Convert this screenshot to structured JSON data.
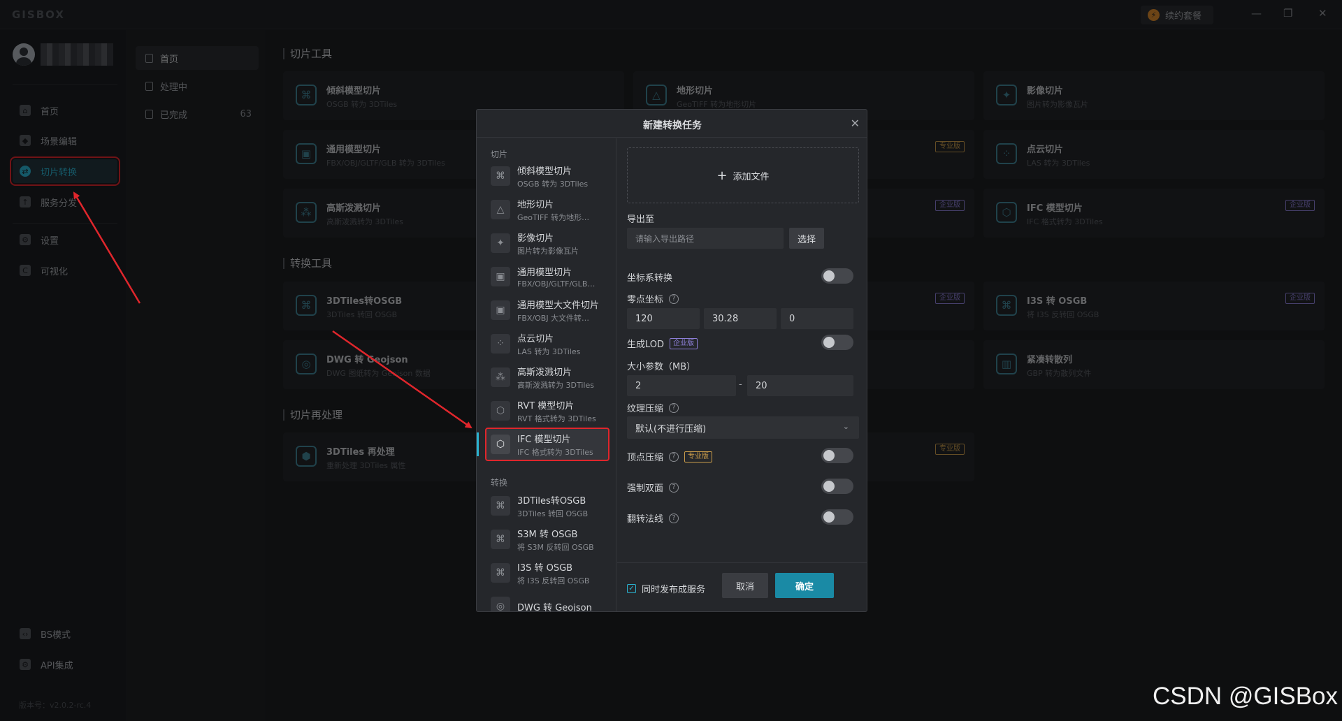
{
  "app": {
    "logo": "GISBOX",
    "renew_label": "续约套餐",
    "window_controls": [
      "—",
      "❐",
      "✕"
    ],
    "version": "版本号：v2.0.2-rc.4"
  },
  "leftnav": {
    "items": [
      {
        "label": "首页",
        "icon": "home-icon"
      },
      {
        "label": "场景编辑",
        "icon": "cube-icon"
      },
      {
        "label": "切片转换",
        "icon": "convert-icon"
      },
      {
        "label": "服务分发",
        "icon": "upload-icon"
      },
      {
        "label": "设置",
        "icon": "gear-icon"
      },
      {
        "label": "可视化",
        "icon": "chart-icon"
      }
    ],
    "bottom": [
      {
        "label": "BS模式",
        "icon": "code-icon"
      },
      {
        "label": "API集成",
        "icon": "api-icon"
      }
    ]
  },
  "subnav": {
    "items": [
      {
        "label": "首页",
        "count": ""
      },
      {
        "label": "处理中",
        "count": ""
      },
      {
        "label": "已完成",
        "count": "63"
      }
    ]
  },
  "main": {
    "sections": [
      "切片工具",
      "转换工具",
      "切片再处理"
    ],
    "cards": [
      {
        "title": "倾斜模型切片",
        "sub": "OSGB 转为 3DTiles",
        "badge": ""
      },
      {
        "title": "地形切片",
        "sub": "GeoTIFF 转为地形切片",
        "badge": ""
      },
      {
        "title": "影像切片",
        "sub": "图片转为影像瓦片",
        "badge": ""
      },
      {
        "title": "通用模型切片",
        "sub": "FBX/OBJ/GLTF/GLB 转为 3DTiles",
        "badge": ""
      },
      {
        "title": "",
        "sub": "",
        "badge": "专业版"
      },
      {
        "title": "点云切片",
        "sub": "LAS 转为 3DTiles",
        "badge": ""
      },
      {
        "title": "高斯泼溅切片",
        "sub": "高斯泼溅转为 3DTiles",
        "badge": ""
      },
      {
        "title": "",
        "sub": "",
        "badge": "企业版"
      },
      {
        "title": "IFC 模型切片",
        "sub": "IFC 格式转为 3DTiles",
        "badge": "企业版"
      },
      {
        "title": "3DTiles转OSGB",
        "sub": "3DTiles 转回 OSGB",
        "badge": ""
      },
      {
        "title": "",
        "sub": "",
        "badge": "企业版"
      },
      {
        "title": "I3S 转 OSGB",
        "sub": "将 I3S 反转回 OSGB",
        "badge": "企业版"
      },
      {
        "title": "DWG 转 Geojson",
        "sub": "DWG 图纸转为 Geojson 数据",
        "badge": ""
      },
      {
        "title": "紧凑转散列",
        "sub": "GBP 转为散列文件",
        "badge": ""
      },
      {
        "title": "3DTiles 再处理",
        "sub": "重新处理 3DTiles 属性",
        "badge": ""
      },
      {
        "title": "",
        "sub": "",
        "badge": "专业版"
      }
    ]
  },
  "modal": {
    "title": "新建转换任务",
    "group_slice": "切片",
    "group_convert": "转换",
    "slice_items": [
      {
        "title": "倾斜模型切片",
        "sub": "OSGB 转为 3DTiles"
      },
      {
        "title": "地形切片",
        "sub": "GeoTIFF 转为地形…"
      },
      {
        "title": "影像切片",
        "sub": "图片转为影像瓦片"
      },
      {
        "title": "通用模型切片",
        "sub": "FBX/OBJ/GLTF/GLB…"
      },
      {
        "title": "通用模型大文件切片",
        "sub": "FBX/OBJ 大文件转…"
      },
      {
        "title": "点云切片",
        "sub": "LAS 转为 3DTiles"
      },
      {
        "title": "高斯泼溅切片",
        "sub": "高斯泼溅转为 3DTiles"
      },
      {
        "title": "RVT 模型切片",
        "sub": "RVT 格式转为 3DTiles"
      },
      {
        "title": "IFC 模型切片",
        "sub": "IFC 格式转为 3DTiles"
      }
    ],
    "convert_items": [
      {
        "title": "3DTiles转OSGB",
        "sub": "3DTiles 转回 OSGB"
      },
      {
        "title": "S3M 转 OSGB",
        "sub": "将 S3M 反转回 OSGB"
      },
      {
        "title": "I3S 转 OSGB",
        "sub": "将 I3S 反转回 OSGB"
      },
      {
        "title": "DWG 转 Geojson",
        "sub": ""
      }
    ],
    "selected": "IFC 模型切片",
    "add_file": "添加文件",
    "export_label": "导出至",
    "export_placeholder": "请输入导出路径",
    "choose_btn": "选择",
    "coord_label": "坐标系转换",
    "origin_label": "零点坐标",
    "origin": {
      "x": "120",
      "y": "30.28",
      "z": "0"
    },
    "lod_label": "生成LOD",
    "lod_badge": "企业版",
    "size_label": "大小参数（MB）",
    "size_min": "2",
    "size_sep": "-",
    "size_max": "20",
    "texture_label": "纹理压缩",
    "texture_value": "默认(不进行压缩)",
    "vertex_label": "顶点压缩",
    "vertex_badge": "专业版",
    "double_label": "强制双面",
    "normal_label": "翻转法线",
    "publish_label": "同时发布成服务",
    "cancel": "取消",
    "ok": "确定",
    "close": "✕"
  },
  "watermark": "CSDN @GISBox"
}
